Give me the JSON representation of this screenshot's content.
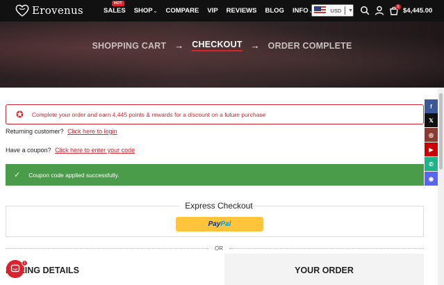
{
  "header": {
    "logo_text": "Erovenus",
    "nav": [
      {
        "label": "SALES",
        "badge": "HOT",
        "has_caret": false
      },
      {
        "label": "SHOP",
        "has_caret": true
      },
      {
        "label": "COMPARE",
        "has_caret": false
      },
      {
        "label": "VIP",
        "has_caret": false
      },
      {
        "label": "REVIEWS",
        "has_caret": false
      },
      {
        "label": "BLOG",
        "has_caret": false
      },
      {
        "label": "INFO",
        "has_caret": true
      }
    ],
    "currency": "USD",
    "cart_count": "0",
    "cart_total": "$4,445.00"
  },
  "steps": [
    "SHOPPING CART",
    "CHECKOUT",
    "ORDER COMPLETE"
  ],
  "rewards_notice": "Complete your order and earn 4,445 points & rewards for a discount on a future purchase",
  "returning": {
    "text": "Returning customer?",
    "link": "Click here to login"
  },
  "coupon": {
    "text": "Have a coupon?",
    "link": "Click here to enter your code"
  },
  "success_message": "Coupon code applied successfully.",
  "express": {
    "title": "Express Checkout",
    "paypal_a": "Pay",
    "paypal_b": "Pal"
  },
  "or_label": "OR",
  "billing_title": "BILLING DETAILS",
  "order_title": "YOUR ORDER",
  "chat_badge": "1",
  "colors": {
    "accent": "#d9232d",
    "success": "#4a9c4a",
    "paypal": "#ffc439"
  },
  "social": [
    {
      "name": "facebook",
      "glyph": "f",
      "color": "#3b5998"
    },
    {
      "name": "x",
      "glyph": "𝕏",
      "color": "#111111"
    },
    {
      "name": "instagram",
      "glyph": "◎",
      "color": "#8a3a2e"
    },
    {
      "name": "youtube",
      "glyph": "▶",
      "color": "#cc0000"
    },
    {
      "name": "whatsapp",
      "glyph": "✆",
      "color": "#1eb389"
    },
    {
      "name": "discord",
      "glyph": "◉",
      "color": "#5865f2"
    }
  ]
}
